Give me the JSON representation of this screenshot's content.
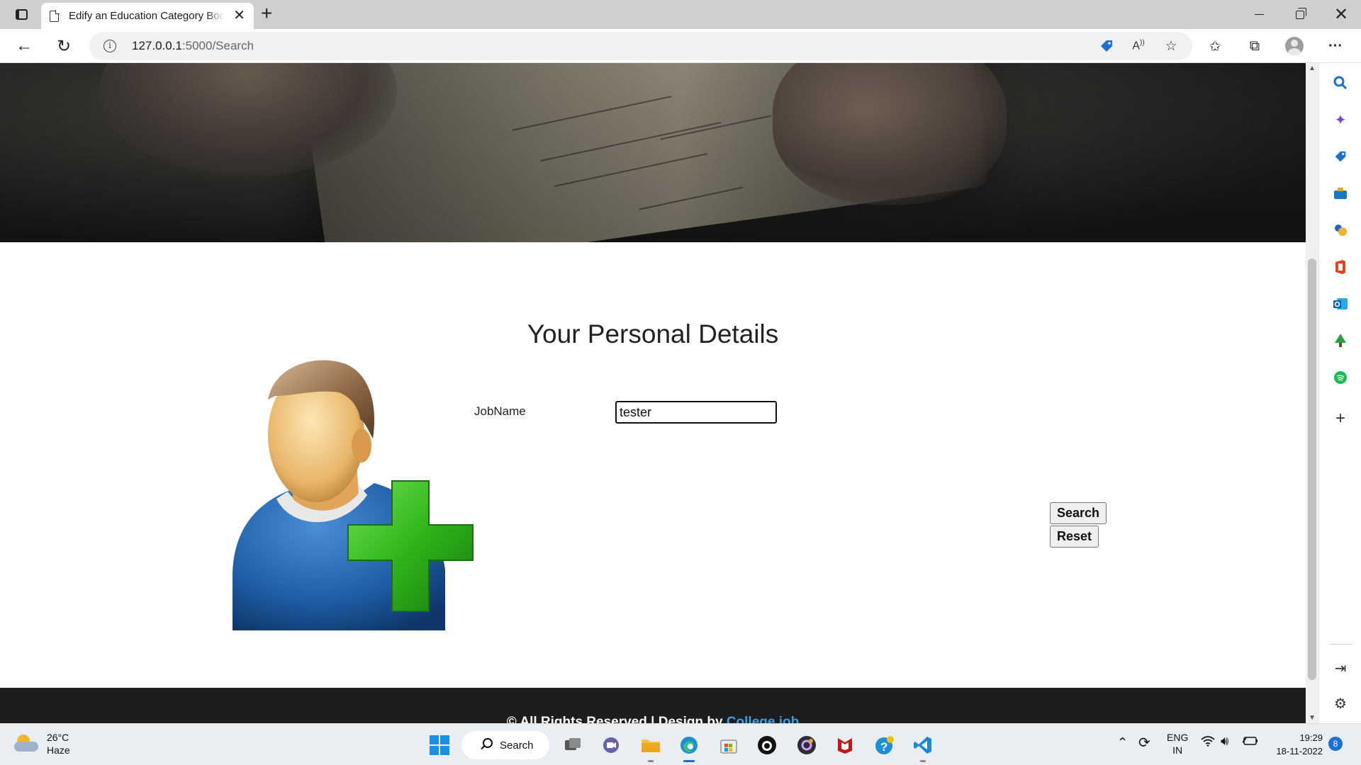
{
  "browser": {
    "tab_title": "Edify an Education Category Boo",
    "url_host": "127.0.0.1",
    "url_rest": ":5000/Search"
  },
  "page": {
    "heading": "Your Personal Details",
    "field_label": "JobName",
    "field_value": "tester",
    "search_button": "Search",
    "reset_button": "Reset",
    "footer_text": "© All Rights Reserved | Design by ",
    "footer_link": "College job"
  },
  "taskbar": {
    "temperature": "26°C",
    "condition": "Haze",
    "search_label": "Search",
    "lang_line1": "ENG",
    "lang_line2": "IN",
    "time": "19:29",
    "date": "18-11-2022",
    "notification_count": "8"
  },
  "colors": {
    "accent": "#1b6fd6",
    "footer_link": "#3aa0e8",
    "plus_green": "#2fb51a",
    "shirt_blue": "#1f5fa8"
  }
}
